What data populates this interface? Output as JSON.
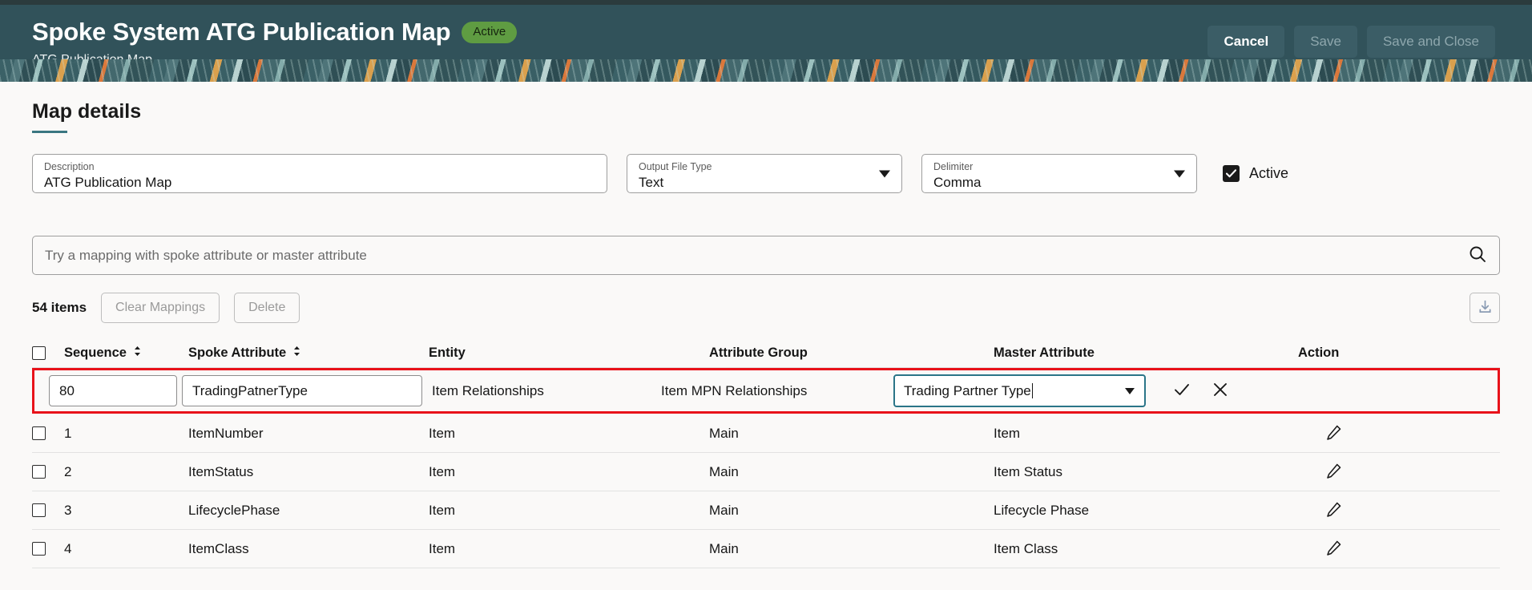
{
  "header": {
    "title": "Spoke System ATG Publication Map",
    "badge": "Active",
    "subtitle": "ATG Publication Map",
    "actions": {
      "cancel": "Cancel",
      "save": "Save",
      "save_and_close": "Save and Close"
    },
    "colors": {
      "background": "#31525a",
      "badge": "#5f9c42"
    }
  },
  "main": {
    "section_title": "Map details",
    "fields": {
      "description": {
        "label": "Description",
        "value": "ATG Publication Map"
      },
      "output_file_type": {
        "label": "Output File Type",
        "value": "Text"
      },
      "delimiter": {
        "label": "Delimiter",
        "value": "Comma"
      },
      "active": {
        "label": "Active",
        "checked": true
      }
    },
    "search": {
      "placeholder": "Try a mapping with spoke attribute or master attribute",
      "value": ""
    },
    "toolbar": {
      "items_count": "54 items",
      "clear_mappings": "Clear Mappings",
      "delete": "Delete",
      "download_icon": "download-icon"
    },
    "table": {
      "columns": [
        "Sequence",
        "Spoke Attribute",
        "Entity",
        "Attribute Group",
        "Master Attribute",
        "Action"
      ],
      "edit_row": {
        "sequence": "80",
        "spoke_attribute": "TradingPatnerType",
        "entity": "Item Relationships",
        "attribute_group": "Item MPN Relationships",
        "master_attribute": "Trading Partner Type",
        "confirm_icon": "check-icon",
        "cancel_icon": "close-icon"
      },
      "rows": [
        {
          "sequence": "1",
          "spoke_attribute": "ItemNumber",
          "entity": "Item",
          "attribute_group": "Main",
          "master_attribute": "Item",
          "action_icon": "edit-pencil-icon"
        },
        {
          "sequence": "2",
          "spoke_attribute": "ItemStatus",
          "entity": "Item",
          "attribute_group": "Main",
          "master_attribute": "Item Status",
          "action_icon": "edit-pencil-icon"
        },
        {
          "sequence": "3",
          "spoke_attribute": "LifecyclePhase",
          "entity": "Item",
          "attribute_group": "Main",
          "master_attribute": "Lifecycle Phase",
          "action_icon": "edit-pencil-icon"
        },
        {
          "sequence": "4",
          "spoke_attribute": "ItemClass",
          "entity": "Item",
          "attribute_group": "Main",
          "master_attribute": "Item Class",
          "action_icon": "edit-pencil-icon"
        }
      ]
    }
  }
}
